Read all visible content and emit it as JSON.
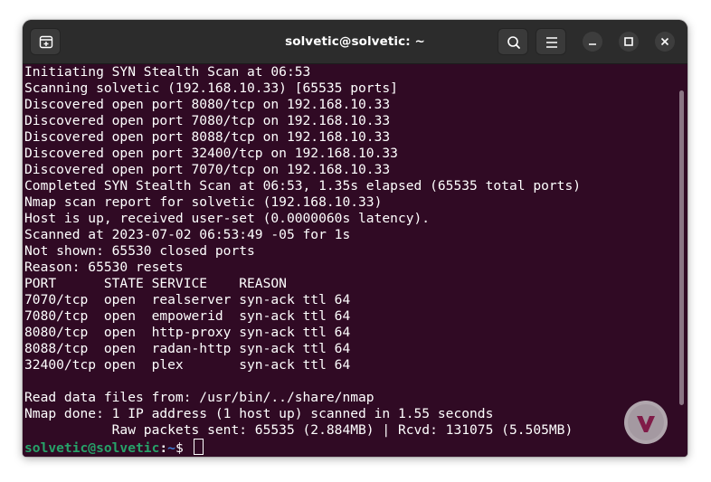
{
  "window": {
    "title": "solvetic@solvetic: ~"
  },
  "toolbar": {
    "new_tab_icon": "new-tab-icon",
    "search_icon": "search-icon",
    "menu_icon": "hamburger-menu-icon",
    "minimize_icon": "minimize-icon",
    "maximize_icon": "maximize-icon",
    "close_icon": "close-icon"
  },
  "colors": {
    "terminal_bg": "#300a24",
    "titlebar_bg": "#2c2c2c",
    "prompt_user": "#26a269",
    "prompt_path": "#3d7ed8"
  },
  "terminal": {
    "lines": [
      "Initiating SYN Stealth Scan at 06:53",
      "Scanning solvetic (192.168.10.33) [65535 ports]",
      "Discovered open port 8080/tcp on 192.168.10.33",
      "Discovered open port 7080/tcp on 192.168.10.33",
      "Discovered open port 8088/tcp on 192.168.10.33",
      "Discovered open port 32400/tcp on 192.168.10.33",
      "Discovered open port 7070/tcp on 192.168.10.33",
      "Completed SYN Stealth Scan at 06:53, 1.35s elapsed (65535 total ports)",
      "Nmap scan report for solvetic (192.168.10.33)",
      "Host is up, received user-set (0.0000060s latency).",
      "Scanned at 2023-07-02 06:53:49 -05 for 1s",
      "Not shown: 65530 closed ports",
      "Reason: 65530 resets",
      "PORT      STATE SERVICE    REASON",
      "7070/tcp  open  realserver syn-ack ttl 64",
      "7080/tcp  open  empowerid  syn-ack ttl 64",
      "8080/tcp  open  http-proxy syn-ack ttl 64",
      "8088/tcp  open  radan-http syn-ack ttl 64",
      "32400/tcp open  plex       syn-ack ttl 64",
      "",
      "Read data files from: /usr/bin/../share/nmap",
      "Nmap done: 1 IP address (1 host up) scanned in 1.55 seconds",
      "           Raw packets sent: 65535 (2.884MB) | Rcvd: 131075 (5.505MB)"
    ],
    "prompt": {
      "user": "solvetic@solvetic",
      "sep": ":",
      "path": "~",
      "symbol": "$ "
    }
  }
}
